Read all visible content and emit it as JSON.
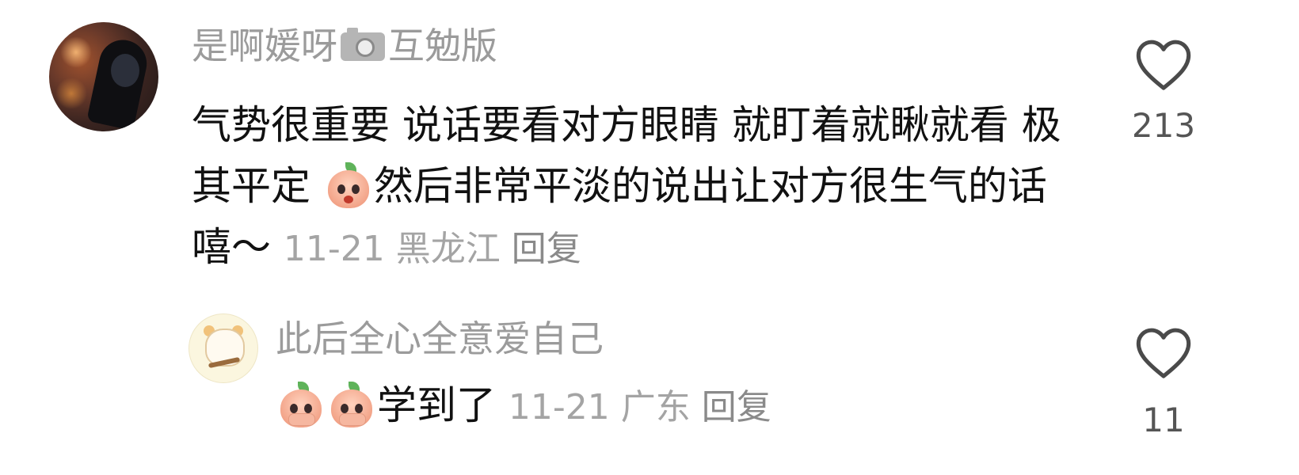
{
  "comments": [
    {
      "author": "是啊媛呀",
      "author_suffix": "互勉版",
      "avatar_icon": "user-avatar-photo",
      "name_icon": "camera-icon",
      "text_part1": "气势很重要 说话要看对方眼睛 就盯着就瞅就看 极其平定 ",
      "emoji": "peach-shocked-emoji",
      "text_part2": "然后非常平淡的说出让对方很生气的话 嘻～ ",
      "date": "11-21",
      "location": "黑龙江",
      "reply_label": "回复",
      "like_icon": "heart-icon",
      "likes": "213"
    },
    {
      "author": "此后全心全意爱自己",
      "avatar_icon": "cartoon-avatar",
      "emojis": [
        "peach-covering-mouth-emoji",
        "peach-covering-mouth-emoji"
      ],
      "text": "学到了 ",
      "date": "11-21",
      "location": "广东",
      "reply_label": "回复",
      "like_icon": "heart-icon",
      "likes": "11"
    }
  ],
  "colors": {
    "name_gray": "#9b9b9b",
    "text_black": "#111111",
    "meta_gray": "#a4a4a4",
    "heart_stroke": "#4a4a4a"
  }
}
